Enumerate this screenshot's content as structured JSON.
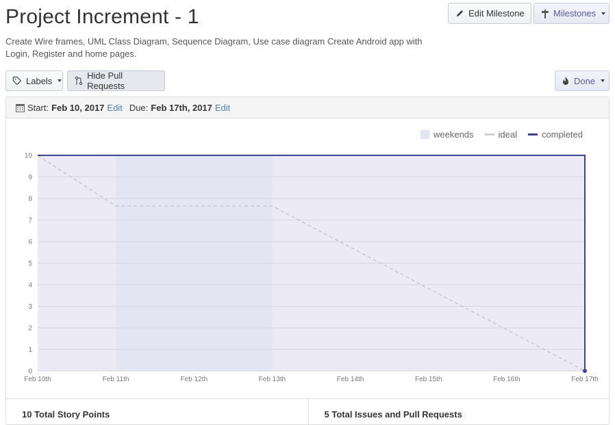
{
  "milestone": {
    "title": "Project Increment - 1",
    "description": "Create Wire frames, UML Class Diagram, Sequence Diagram, Use case diagram Create Android app with Login, Register and home pages."
  },
  "header_buttons": {
    "edit_milestone": "Edit Milestone",
    "milestones": "Milestones"
  },
  "toolbar": {
    "labels": "Labels",
    "hide_pull_requests": "Hide Pull Requests",
    "done": "Done"
  },
  "dates": {
    "start_label": "Start:",
    "start_value": "Feb 10, 2017",
    "start_edit": "Edit",
    "due_label": "Due:",
    "due_value": "Feb 17th, 2017",
    "due_edit": "Edit"
  },
  "legend": {
    "weekends": "weekends",
    "ideal": "ideal",
    "completed": "completed"
  },
  "chart_data": {
    "type": "line",
    "x": [
      "Feb 10th",
      "Feb 11th",
      "Feb 12th",
      "Feb 13th",
      "Feb 14th",
      "Feb 15th",
      "Feb 16th",
      "Feb 17th"
    ],
    "yticks": [
      0,
      1,
      2,
      3,
      4,
      5,
      6,
      7,
      8,
      9,
      10
    ],
    "ylim": [
      0,
      10
    ],
    "weekend_range": [
      1,
      3
    ],
    "series": [
      {
        "name": "ideal",
        "color": "#c2c2cc",
        "style": "dashed",
        "points": [
          [
            0,
            10
          ],
          [
            1,
            7.65
          ],
          [
            3,
            7.65
          ],
          [
            7,
            0
          ]
        ]
      },
      {
        "name": "completed",
        "color": "#3d4491",
        "style": "solid",
        "points": [
          [
            0,
            10
          ],
          [
            7,
            10
          ],
          [
            7,
            0
          ]
        ]
      }
    ],
    "grid": true,
    "legend_position": "top-right",
    "colors": {
      "plot_background": "#ecebf5",
      "weekend": "#e3e5f2",
      "gridline": "#d6d6e0"
    }
  },
  "stats": {
    "story_points": "10 Total Story Points",
    "issues_prs": "5 Total Issues and Pull Requests"
  }
}
